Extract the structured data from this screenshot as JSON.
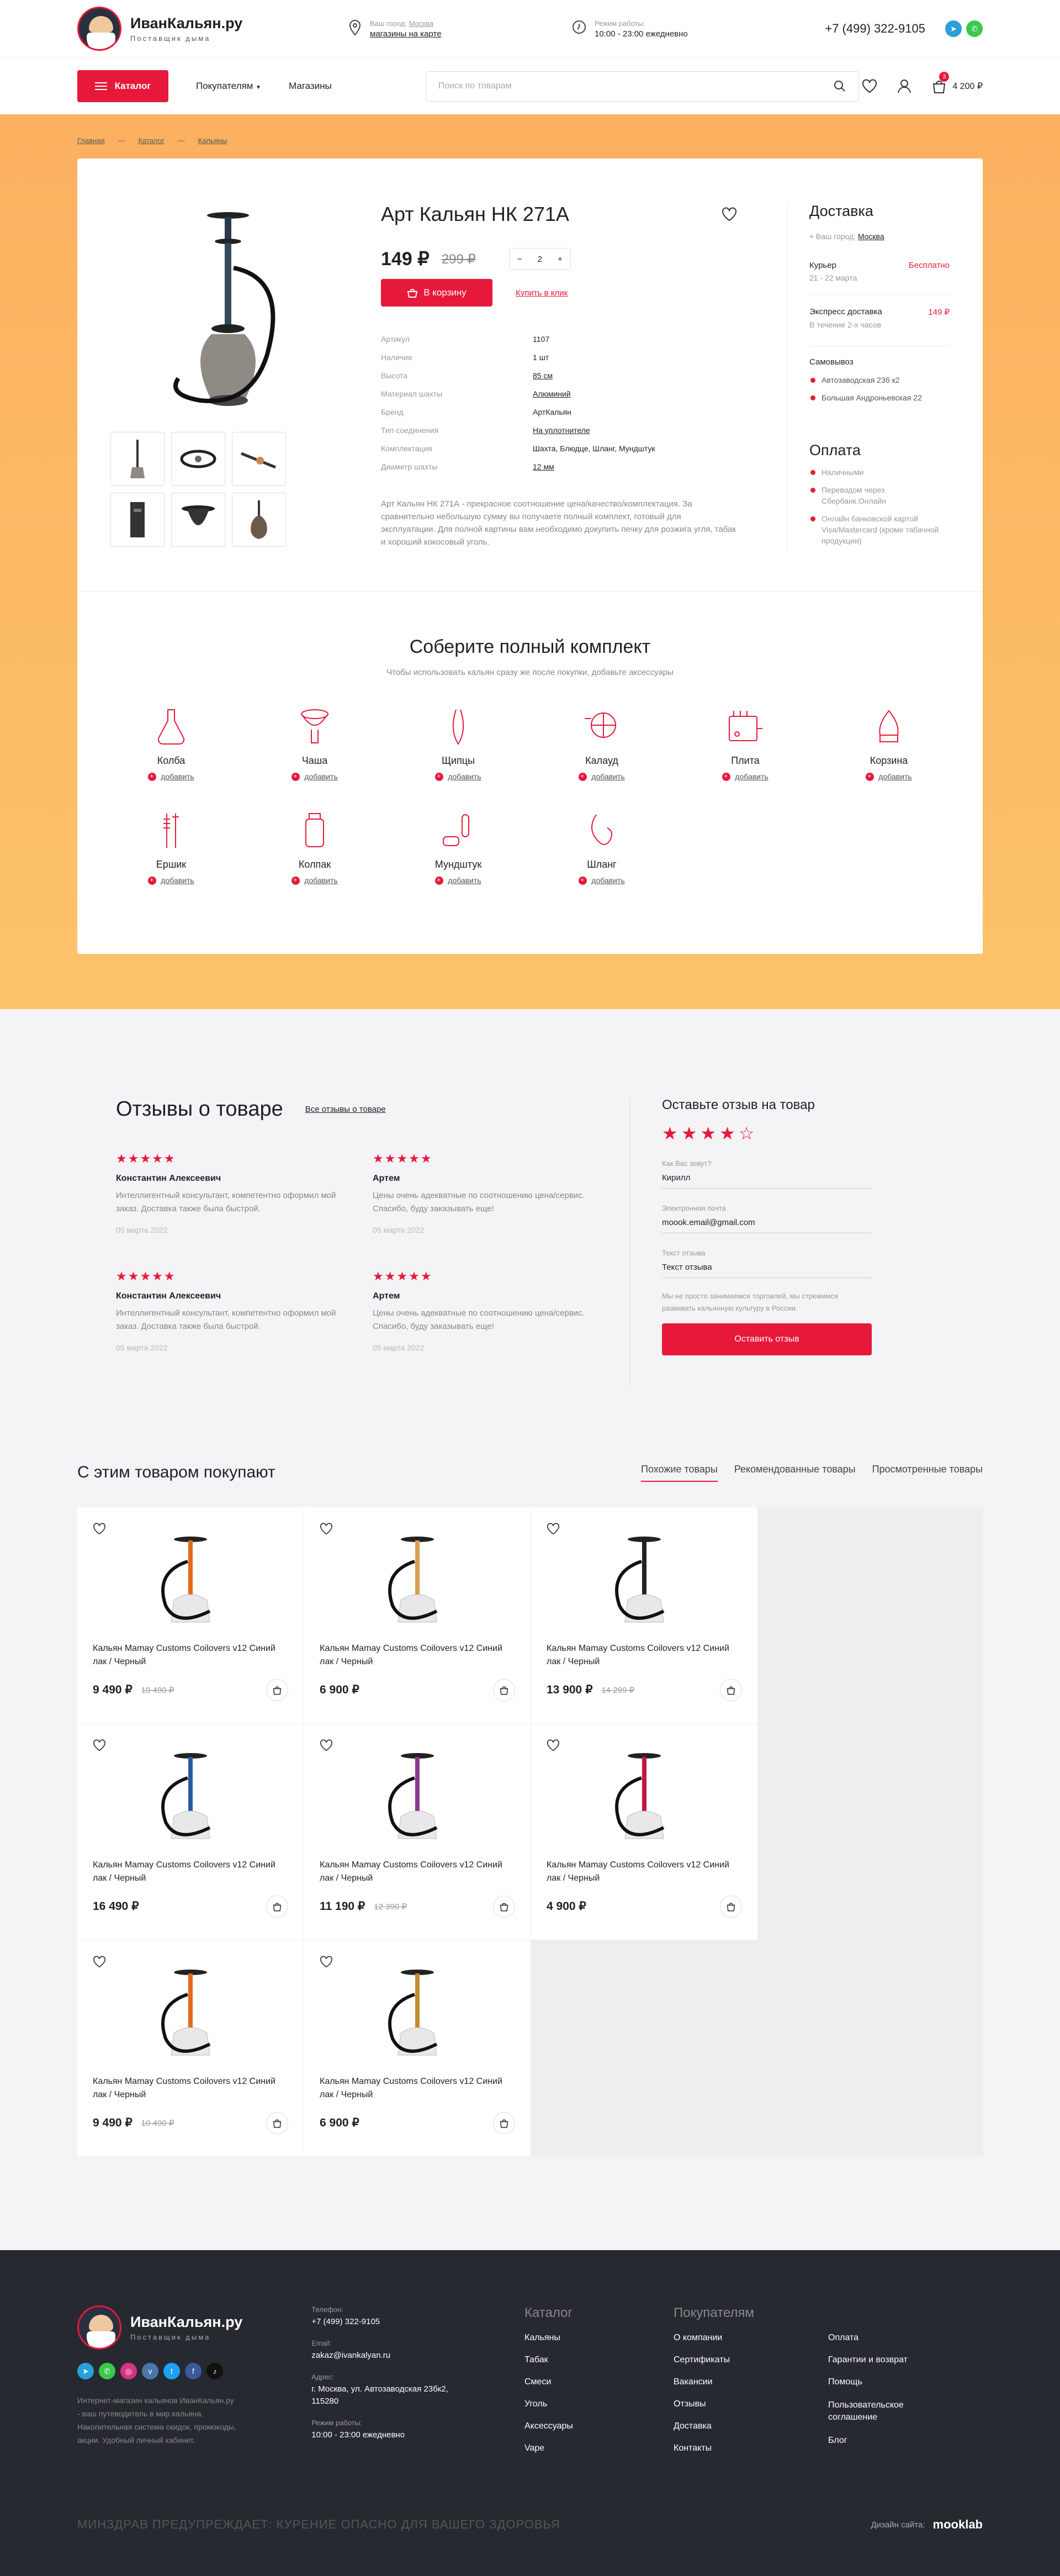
{
  "header": {
    "logo_title": "ИванКальян.ру",
    "logo_sub": "Поставщик дыма",
    "city_label": "Ваш город:",
    "city": "Москва",
    "stores_link": "магазины на карте",
    "hours_label": "Режим работы:",
    "hours": "10:00 - 23:00 ежедневно",
    "phone": "+7 (499) 322-9105"
  },
  "nav": {
    "catalog": "Каталог",
    "buyers": "Покупателям",
    "stores": "Магазины",
    "search_placeholder": "Поиск по товарам",
    "cart_count": "3",
    "cart_total": "4 200 ₽"
  },
  "breadcrumbs": [
    "Главная",
    "Каталог",
    "Кальяны"
  ],
  "product": {
    "title": "Арт Кальян НК 271А",
    "price": "149 ₽",
    "old_price": "299 ₽",
    "qty": "2",
    "qty_minus": "−",
    "qty_plus": "+",
    "buy": "В корзину",
    "one_click": "Купить в клик",
    "specs": [
      {
        "k": "Артикул",
        "v": "1107"
      },
      {
        "k": "Наличие",
        "v": "1 шт"
      },
      {
        "k": "Высота",
        "v": "85 см"
      },
      {
        "k": "Материал шахты",
        "v": "Алюминий"
      },
      {
        "k": "Бренд",
        "v": "АртКальян"
      },
      {
        "k": "Тип соединения",
        "v": "На уплотнителе"
      },
      {
        "k": "Комплектация",
        "v": "Шахта, Блюдце, Шланг, Мундштук"
      },
      {
        "k": "Диаметр шахты",
        "v": "12 мм"
      }
    ],
    "description": "Арт Кальян НК 271А - прекрасное соотношение цена/качество/комплектация. За сравнительно небольшую сумму вы получаете полный комплект, готовый для эксплуатации. Для полной картины вам необходимо докупить печку для розжига угля, табак и хороший кокосовый уголь."
  },
  "delivery": {
    "title": "Доставка",
    "city_label": "Ваш город:",
    "city": "Москва",
    "courier": "Курьер",
    "courier_price": "Бесплатно",
    "courier_date": "21 - 22 марта",
    "express": "Экспресс доставка",
    "express_price": "149 ₽",
    "express_time": "В течение 2-х часов",
    "pickup": "Самовывоз",
    "pickup_points": [
      "Автозаводская 23б к2",
      "Большая Андроньевская 22"
    ],
    "pay_title": "Оплата",
    "pay_methods": [
      "Наличными",
      "Переводом через Сбербанк.Онлайн",
      "Онлайн банковской картой Visa/Mastercard (кроме табачной продукции)"
    ]
  },
  "kit": {
    "title": "Соберите полный комплект",
    "subtitle": "Чтобы использовать кальян сразу же после покупки, добавьте аксессуары",
    "add": "добавить",
    "items": [
      "Колба",
      "Чаша",
      "Щипцы",
      "Калауд",
      "Плита",
      "Корзина",
      "Ершик",
      "Колпак",
      "Мундштук",
      "Шланг"
    ]
  },
  "reviews": {
    "title": "Отзывы о товаре",
    "all": "Все отзывы о товаре",
    "items": [
      {
        "stars": "★★★★★",
        "name": "Константин Алексеевич",
        "text": "Интеллигентный консультант, компетентно оформил мой заказ. Доставка также была быстрой.",
        "date": "05 марта 2022"
      },
      {
        "stars": "★★★★★",
        "name": "Артем",
        "text": "Цены очень адекватные по соотношению цена/сервис. Спасибо, буду заказывать еще!",
        "date": "05 марта 2022"
      },
      {
        "stars": "★★★★★",
        "name": "Константин Алексеевич",
        "text": "Интеллигентный консультант, компетентно оформил мой заказ. Доставка также была быстрой.",
        "date": "05 марта 2022"
      },
      {
        "stars": "★★★★★",
        "name": "Артем",
        "text": "Цены очень адекватные по соотношению цена/сервис. Спасибо, буду заказывать еще!",
        "date": "05 марта 2022"
      }
    ],
    "form_title": "Оставьте отзыв на товар",
    "rating": "★★★★☆",
    "name_label": "Как Вас зовут?",
    "name_value": "Кирилл",
    "email_label": "Электронная почта",
    "email_value": "moook.email@gmail.com",
    "text_label": "Текст отзыва",
    "text_value": "Текст отзыва",
    "note": "Мы не просто занимаемся торговлей, мы стремимся развивать кальянную культуру в России.",
    "submit": "Оставить отзыв"
  },
  "related": {
    "title": "С этим товаром покупают",
    "tabs": [
      "Похожие товары",
      "Рекомендованные товары",
      "Просмотренные товары"
    ],
    "products": [
      {
        "name": "Кальян Mamay Customs Coilovers v12 Синий лак / Черный",
        "price": "9 490 ₽",
        "old": "10 490 ₽"
      },
      {
        "name": "Кальян Mamay Customs Coilovers v12 Синий лак / Черный",
        "price": "6 900 ₽",
        "old": ""
      },
      {
        "name": "Кальян Mamay Customs Coilovers v12 Синий лак / Черный",
        "price": "13 900 ₽",
        "old": "14 299 ₽"
      },
      {
        "name": "Кальян Mamay Customs Coilovers v12 Синий лак / Черный",
        "price": "16 490 ₽",
        "old": ""
      },
      {
        "name": "Кальян Mamay Customs Coilovers v12 Синий лак / Черный",
        "price": "11 190 ₽",
        "old": "12 390 ₽"
      },
      {
        "name": "Кальян Mamay Customs Coilovers v12 Синий лак / Черный",
        "price": "4 900 ₽",
        "old": ""
      },
      {
        "name": "Кальян Mamay Customs Coilovers v12 Синий лак / Черный",
        "price": "9 490 ₽",
        "old": "10 490 ₽"
      },
      {
        "name": "Кальян Mamay Customs Coilovers v12 Синий лак / Черный",
        "price": "6 900 ₽",
        "old": ""
      }
    ]
  },
  "footer": {
    "logo_title": "ИванКальян.ру",
    "logo_sub": "Поставщик дыма",
    "about": "Интернет-магазин кальянов ИванКальян.ру - ваш путеводитель в мир кальяна. Накопительная система скидок, промокоды, акции. Удобный личный кабинет.",
    "phone_label": "Телефон:",
    "phone": "+7 (499) 322-9105",
    "email_label": "Email:",
    "email": "zakaz@ivankalyan.ru",
    "address_label": "Адрес:",
    "address": "г. Москва, ул. Автозаводская 23бк2, 115280",
    "hours_label": "Режим работы:",
    "hours": "10:00 - 23:00 ежедневно",
    "catalog_title": "Каталог",
    "catalog": [
      "Кальяны",
      "Табак",
      "Смеси",
      "Уголь",
      "Аксессуары",
      "Vape"
    ],
    "buyers_title": "Покупателям",
    "buyers_a": [
      "О компании",
      "Сертификаты",
      "Вакансии",
      "Отзывы",
      "Доставка",
      "Контакты"
    ],
    "buyers_b": [
      "Оплата",
      "Гарантии и возврат",
      "Помощь",
      "Пользовательское соглашение",
      "Блог"
    ],
    "warning": "МИНЗДРАВ ПРЕДУПРЕЖДАЕТ: КУРЕНИЕ ОПАСНО ДЛЯ ВАШЕГО ЗДОРОВЬЯ",
    "design_label": "Дизайн сайта:",
    "design_by": "mooklab"
  },
  "colors": {
    "accent": "#e6193a",
    "hero_bg": "#fbb060",
    "footer_bg": "#272930",
    "telegram": "#2a9fd8",
    "whatsapp": "#3cc84a"
  }
}
